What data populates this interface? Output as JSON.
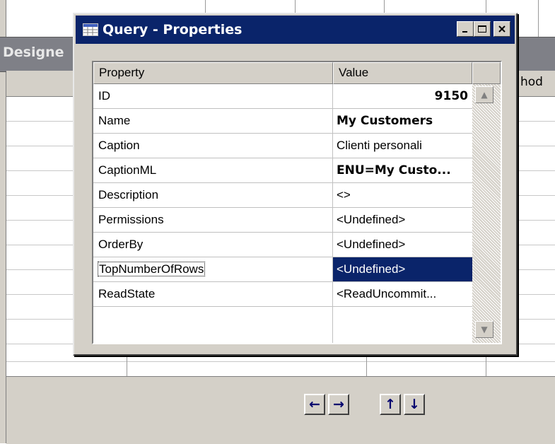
{
  "background": {
    "designer_title": "Designe",
    "header_partial": "hod"
  },
  "dialog": {
    "title": "Query - Properties",
    "controls": {
      "minimize": "_",
      "maximize": "□",
      "close": "✕"
    },
    "grid": {
      "columns": {
        "property": "Property",
        "value": "Value"
      },
      "rows": [
        {
          "name": "ID",
          "value": "9150"
        },
        {
          "name": "Name",
          "value": "My Customers"
        },
        {
          "name": "Caption",
          "value": "Clienti personali"
        },
        {
          "name": "CaptionML",
          "value": "ENU=My Custo..."
        },
        {
          "name": "Description",
          "value": "<>"
        },
        {
          "name": "Permissions",
          "value": "<Undefined>"
        },
        {
          "name": "OrderBy",
          "value": "<Undefined>"
        },
        {
          "name": "TopNumberOfRows",
          "value": "<Undefined>"
        },
        {
          "name": "ReadState",
          "value": "<ReadUncommit..."
        }
      ],
      "scroll": {
        "up": "▲",
        "down": "▼"
      }
    }
  },
  "navigation": {
    "left": "←",
    "right": "→",
    "up": "↑",
    "down": "↓"
  }
}
